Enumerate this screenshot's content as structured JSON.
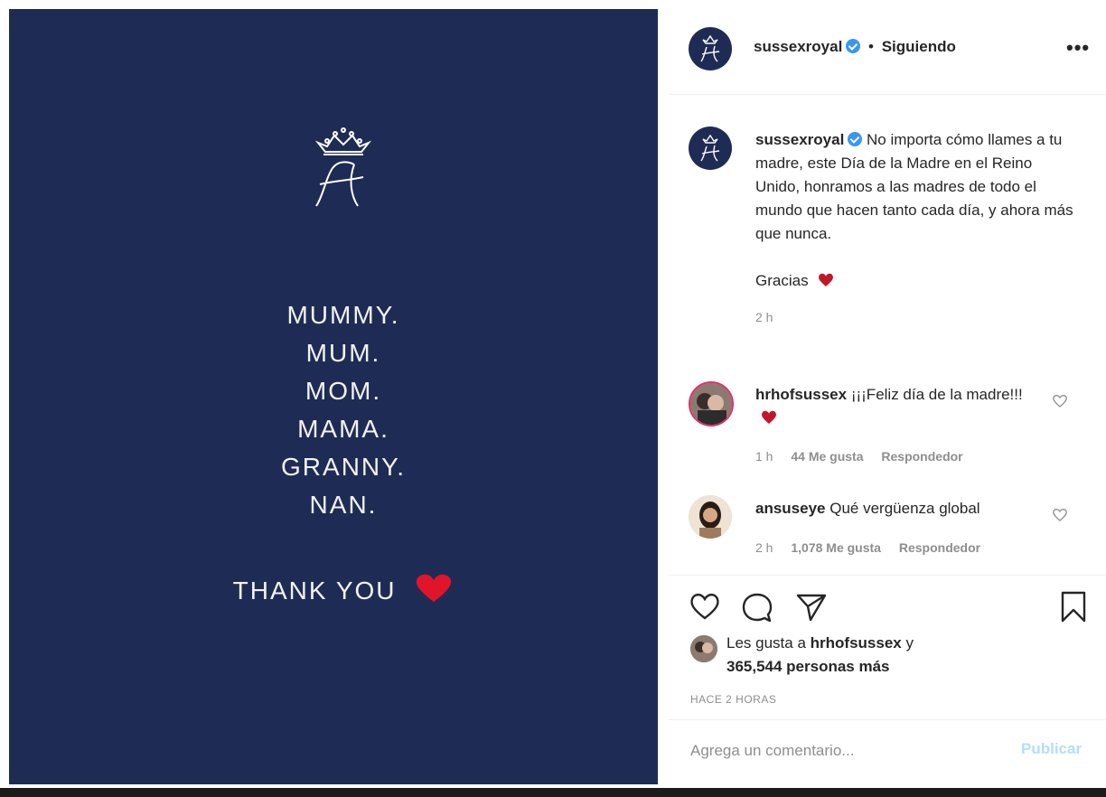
{
  "post_image": {
    "lines": [
      "MUMMY.",
      "MUM.",
      "MOM.",
      "MAMA.",
      "GRANNY.",
      "NAN."
    ],
    "thank_you": "THANK YOU"
  },
  "header": {
    "username": "sussexroyal",
    "separator": "•",
    "follow_status": "Siguiendo",
    "more": "•••"
  },
  "caption": {
    "username": "sussexroyal",
    "text": "No importa cómo llames a tu madre, este Día de la Madre en el Reino Unido, honramos a las madres de todo el mundo que hacen tanto cada día, y ahora más que nunca.",
    "thanks": "Gracias",
    "time": "2 h"
  },
  "comments": [
    {
      "username": "hrhofsussex",
      "text": "¡¡¡Feliz día de la madre!!!",
      "time": "1 h",
      "likes": "44 Me gusta",
      "reply": "Respondedor"
    },
    {
      "username": "ansuseye",
      "text": "Qué vergüenza global",
      "time": "2 h",
      "likes": "1,078 Me gusta",
      "reply": "Respondedor"
    }
  ],
  "likes": {
    "prefix": "Les gusta a",
    "user": "hrhofsussex",
    "conj": "y",
    "others": "365,544 personas más"
  },
  "timestamp": "HACE 2 HORAS",
  "comment_box": {
    "placeholder": "Agrega un comentario...",
    "publish": "Publicar"
  },
  "colors": {
    "card_background": "#1e2c55",
    "heart_red": "#e0142a",
    "verified_blue": "#3897f0",
    "publish_disabled": "#b2dffc"
  }
}
